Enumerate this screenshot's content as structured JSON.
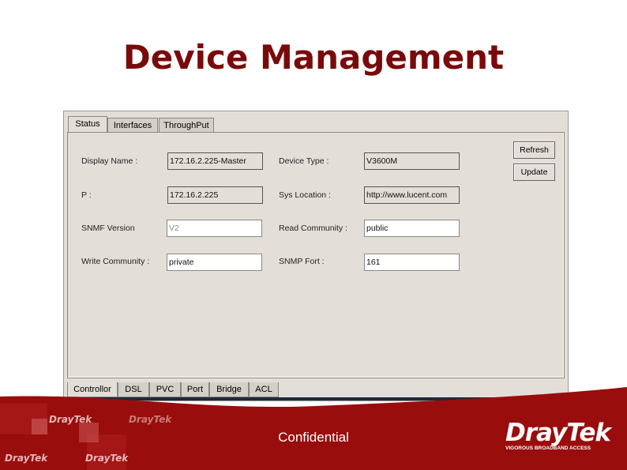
{
  "title": "Device Management",
  "top_tabs": [
    "Status",
    "Interfaces",
    "ThroughPut"
  ],
  "fields": {
    "display_name": {
      "label": "Display Name :",
      "value": "172.16.2.225-Master"
    },
    "ip": {
      "label": "P :",
      "value": "172.16.2.225"
    },
    "snmp_version": {
      "label": "SNMF Version",
      "value": "V2"
    },
    "write_community": {
      "label": "Write Community :",
      "value": "private"
    },
    "device_type": {
      "label": "Device Type :",
      "value": "V3600M"
    },
    "sys_location": {
      "label": "Sys Location :",
      "value": "http://www.lucent.com"
    },
    "read_community": {
      "label": "Read Community :",
      "value": "public"
    },
    "snmp_port": {
      "label": "SNMP Fort :",
      "value": "161"
    }
  },
  "buttons": {
    "refresh": "Refresh",
    "update": "Update"
  },
  "bottom_tabs": [
    "Controllor",
    "DSL",
    "PVC",
    "Port",
    "Bridge",
    "ACL"
  ],
  "footer": {
    "confidential": "Confidential",
    "logo": "DrayTek",
    "tagline": "VIGOROUS BROADBAND ACCESS",
    "watermark": "DrayTek"
  },
  "colors": {
    "title": "#7a0a0a",
    "footer": "#9a0d0d"
  }
}
